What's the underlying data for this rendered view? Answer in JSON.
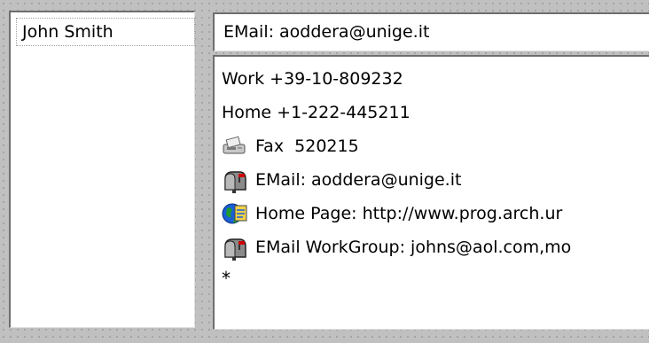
{
  "left_pane": {
    "selected_contact": "John Smith"
  },
  "header": {
    "email_text": "EMail: aoddera@unige.it"
  },
  "details": {
    "work_phone": "Work +39-10-809232",
    "home_phone": "Home +1-222-445211",
    "fax": {
      "icon": "fax-icon",
      "text": "Fax  520215"
    },
    "email": {
      "icon": "mailbox-icon",
      "text": "EMail: aoddera@unige.it"
    },
    "home_page": {
      "icon": "globe-page-icon",
      "text": "Home Page: http://www.prog.arch.ur"
    },
    "email_workgroup": {
      "icon": "mailbox-icon",
      "text": "EMail WorkGroup: johns@aol.com,mo"
    },
    "new_entry_marker": "*"
  },
  "colors": {
    "frame": "#c0c0c0",
    "field_bg": "#ffffff",
    "mailbox_flag": "#d00000",
    "globe_blue": "#1a5fd6",
    "globe_green": "#1f9b2e",
    "page_yellow": "#f2d24a"
  }
}
